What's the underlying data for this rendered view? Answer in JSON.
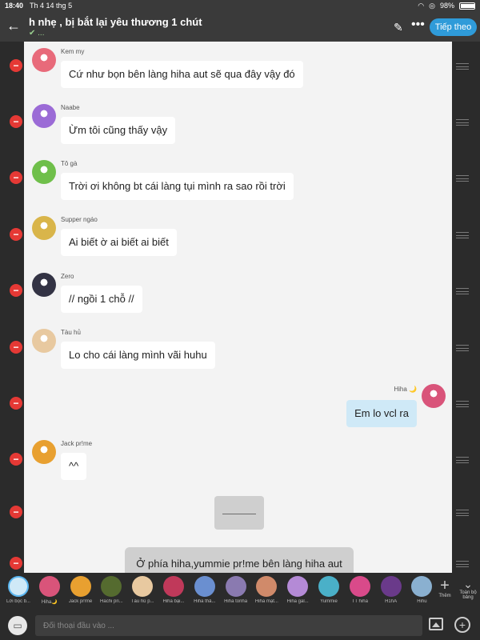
{
  "status": {
    "time": "18:40",
    "date": "Th 4 14 thg 5",
    "battery": "98%",
    "battery_level": 0.98
  },
  "header": {
    "title": "h nhẹ , bị bắt lại yêu thương 1 chút",
    "subtitle": "✔ ...",
    "next_label": "Tiếp theo",
    "icons": [
      "back-arrow-icon",
      "pencil-icon",
      "more-icon"
    ]
  },
  "messages": [
    {
      "sender": "Kem my",
      "text": "Cứ như  bọn bên làng hiha aut sẽ qua đây vậy đó",
      "avatar_color": "#e86a7a"
    },
    {
      "sender": "Naabe",
      "text": "Ừm tôi cũng thấy vậy",
      "avatar_color": "#9b6bd6"
    },
    {
      "sender": "Tô gà",
      "text": "Trời ơi không bt cái làng tụi mình  ra sao rồi trời",
      "avatar_color": "#6fbf4a"
    },
    {
      "sender": "Supper ngáo",
      "text": "Ai biết ờ ai biết ai biết",
      "avatar_color": "#d9b54a"
    },
    {
      "sender": "Zero",
      "text": "// ngồi 1 chỗ //",
      "avatar_color": "#333344"
    },
    {
      "sender": "Tàu hủ",
      "text": "Lo cho cái làng mình vãi huhu",
      "avatar_color": "#e8c9a0"
    }
  ],
  "my_message": {
    "sender": "Hiha 🌙",
    "text": "Em lo vcl ra",
    "avatar_color": "#d9547a"
  },
  "last_message": {
    "sender": "Jack pr!me",
    "text": "^^",
    "avatar_color": "#e8a030"
  },
  "system_message": {
    "text": "———"
  },
  "narration": {
    "text": "Ở phía  hiha,yummie pr!me bên làng hiha aut"
  },
  "members": [
    {
      "name": "Lời bọc b...",
      "color": "#5bb6f0",
      "selected": true
    },
    {
      "name": "Hiha🌙",
      "color": "#d9547a"
    },
    {
      "name": "Jack pr!me",
      "color": "#e8a030"
    },
    {
      "name": "Hachi pri...",
      "color": "#556b2f"
    },
    {
      "name": "Tàu hủ p...",
      "color": "#e8c9a0"
    },
    {
      "name": "Hiha bại...",
      "color": "#c0395a"
    },
    {
      "name": "Hiha thả...",
      "color": "#6a8fd0"
    },
    {
      "name": "Hiha tonha",
      "color": "#8a7ab0"
    },
    {
      "name": "Hiha mặt...",
      "color": "#d08a6a"
    },
    {
      "name": "Hiha gal...",
      "color": "#b48ad6"
    },
    {
      "name": "Yummie",
      "color": "#4ab0c8"
    },
    {
      "name": "TT hiha",
      "color": "#d94a8a"
    },
    {
      "name": "H1hA",
      "color": "#6a3a8a"
    },
    {
      "name": "Hihu",
      "color": "#8ab0d0"
    }
  ],
  "add_member_label": "Thêm",
  "fullscreen_label": "Toàn bộ bảng",
  "input": {
    "placeholder": "Đối thoại đầu vào ..."
  }
}
